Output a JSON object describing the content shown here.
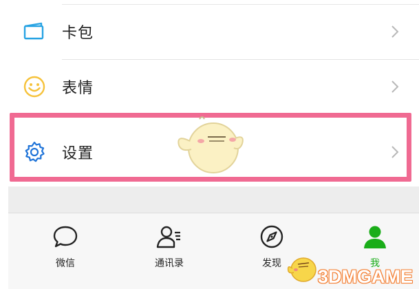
{
  "list": {
    "items": [
      {
        "label": "卡包",
        "icon": "card-wallet-icon"
      },
      {
        "label": "表情",
        "icon": "emoji-smile-icon"
      },
      {
        "label": "设置",
        "icon": "settings-gear-icon"
      }
    ]
  },
  "tabbar": {
    "tabs": [
      {
        "label": "微信",
        "icon": "chat-bubble-icon"
      },
      {
        "label": "通讯录",
        "icon": "contacts-icon"
      },
      {
        "label": "发现",
        "icon": "compass-icon"
      },
      {
        "label": "我",
        "icon": "person-icon",
        "active": true
      }
    ]
  },
  "watermark": {
    "text": "3DMGAME"
  },
  "colors": {
    "highlight": "#f06a92",
    "accent_green": "#1aad19",
    "settings_blue": "#1e73d8",
    "card_icon": "#27a3e3",
    "emoji_icon": "#f6c23a"
  }
}
